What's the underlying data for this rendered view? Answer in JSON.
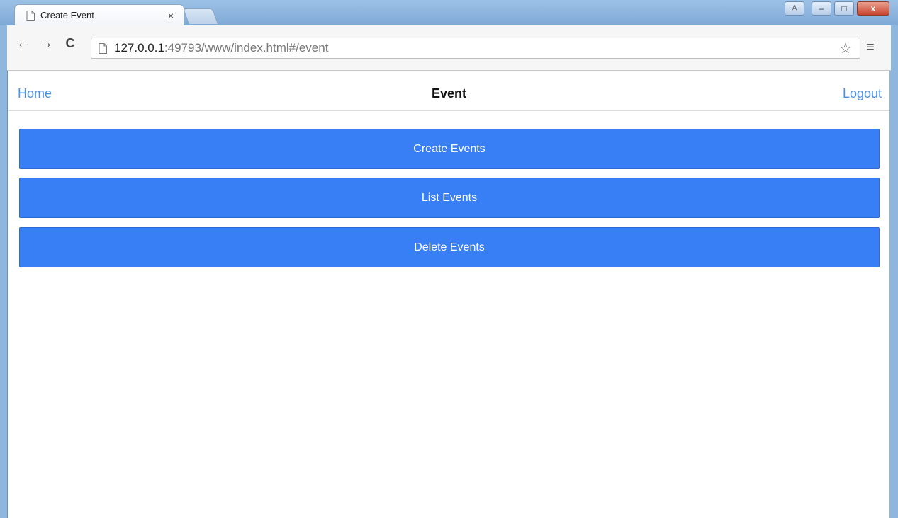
{
  "browser": {
    "tab_title": "Create Event",
    "tab_close": "×",
    "url_host": "127.0.0.1",
    "url_rest": ":49793/www/index.html#/event",
    "back": "←",
    "forward": "→",
    "reload": "C",
    "star": "☆",
    "menu": "≡",
    "win_min": "–",
    "win_max": "□",
    "win_close": "x",
    "win_profile": "♙"
  },
  "header": {
    "home_label": "Home",
    "title": "Event",
    "logout_label": "Logout"
  },
  "actions": {
    "create_label": "Create Events",
    "list_label": "List Events",
    "delete_label": "Delete Events"
  },
  "colors": {
    "primary": "#387ef5",
    "link": "#4a90e2"
  }
}
